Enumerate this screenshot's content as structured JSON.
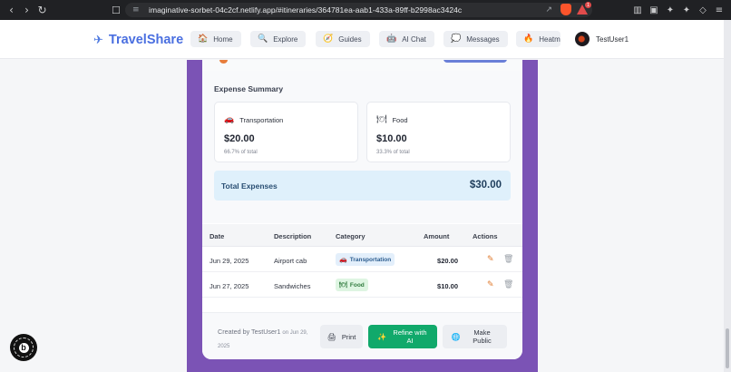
{
  "browser": {
    "url": "imaginative-sorbet-04c2cf.netlify.app/#itineraries/364781ea-aab1-433a-89ff-b2998ac3424c",
    "alert_count": "1",
    "icons": [
      "back-icon",
      "forward-icon",
      "reload-icon",
      "bookmark-icon",
      "share-icon",
      "brave-shield-icon",
      "brave-rewards-icon",
      "sidebar-icon",
      "wallet-icon",
      "extensions-icon",
      "vpn-icon",
      "menu-icon"
    ]
  },
  "header": {
    "brand": "TravelShare",
    "nav": [
      {
        "label": "Home",
        "icon": "🏠"
      },
      {
        "label": "Explore",
        "icon": "🔍"
      },
      {
        "label": "Guides",
        "icon": "🧭"
      },
      {
        "label": "AI Chat",
        "icon": "🤖"
      },
      {
        "label": "Messages",
        "icon": "💭"
      },
      {
        "label": "Heatma",
        "icon": "🔥"
      }
    ],
    "user": "TestUser1"
  },
  "expense_summary": {
    "title": "Expense Summary",
    "categories": [
      {
        "name": "Transportation",
        "icon": "🚗",
        "amount": "$20.00",
        "percent": "66.7% of total"
      },
      {
        "name": "Food",
        "icon": "🍽",
        "amount": "$10.00",
        "percent": "33.3% of total"
      }
    ],
    "total_label": "Total Expenses",
    "total_value": "$30.00"
  },
  "table": {
    "headers": [
      "Date",
      "Description",
      "Category",
      "Amount",
      "Actions"
    ],
    "rows": [
      {
        "date": "Jun 29, 2025",
        "description": "Airport cab",
        "category": "Transportation",
        "category_icon": "🚗",
        "amount": "$20.00"
      },
      {
        "date": "Jun 27, 2025",
        "description": "Sandwiches",
        "category": "Food",
        "category_icon": "🍽",
        "amount": "$10.00"
      }
    ]
  },
  "footer": {
    "created_by": "Created by TestUser1",
    "created_on": "on Jun 29,",
    "created_year": "2025",
    "print_label": "Print",
    "print_icon": "🖨",
    "refine_label": "Refine with AI",
    "refine_icon": "✨",
    "public_label": "Make Public",
    "public_icon": "🌐"
  },
  "colors": {
    "brand": "#4a6fe0",
    "backdrop": "#7b53b5",
    "refine_button": "#11a96b",
    "total_bg": "#dff0fb"
  }
}
